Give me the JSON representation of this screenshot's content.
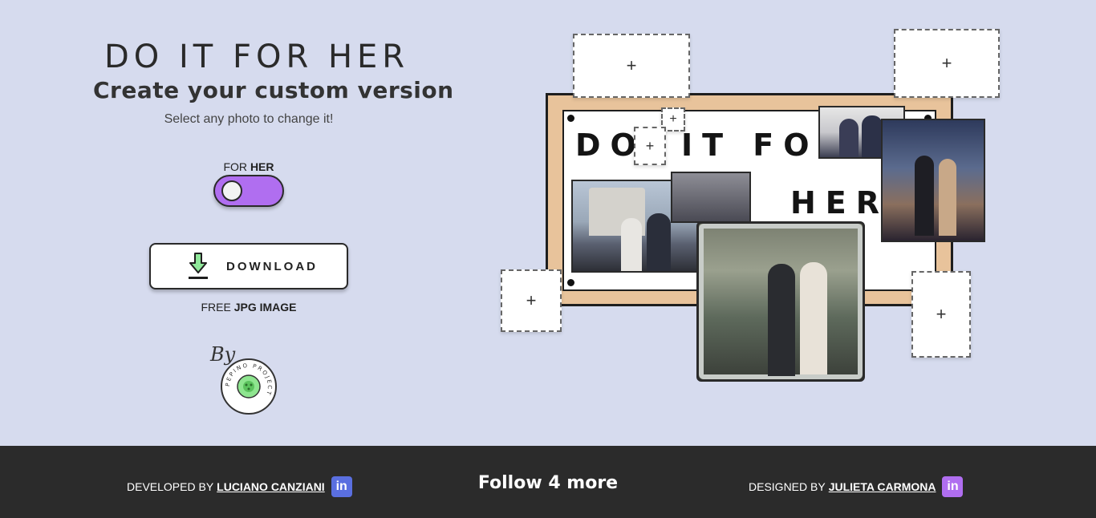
{
  "header": {
    "title": "DO IT FOR HER",
    "subtitle": "Create your custom version",
    "hint": "Select any photo to change it!"
  },
  "toggle": {
    "label_prefix": "FOR",
    "label_bold": "HER",
    "state": "on",
    "accent_color": "#b06ef0"
  },
  "download": {
    "label": "DOWNLOAD",
    "icon": "download-icon",
    "sub_prefix": "FREE",
    "sub_bold": "JPG IMAGE"
  },
  "signature": {
    "by_text": "By",
    "logo_text": "PEPINO PROJECT"
  },
  "collage": {
    "poster_words": [
      "DO",
      "IT FOR",
      "HER"
    ],
    "add_symbol": "+",
    "frame_color": "#e8c39b"
  },
  "footer": {
    "left_prefix": "DEVELOPED BY",
    "left_name": "LUCIANO CANZIANI",
    "left_icon": "linkedin-icon",
    "left_icon_color": "#5a6fe0",
    "center": "Follow 4 more",
    "right_prefix": "DESIGNED BY",
    "right_name": "JULIETA CARMONA",
    "right_icon": "linkedin-icon",
    "right_icon_color": "#b06ef0",
    "icon_glyph": "in"
  }
}
